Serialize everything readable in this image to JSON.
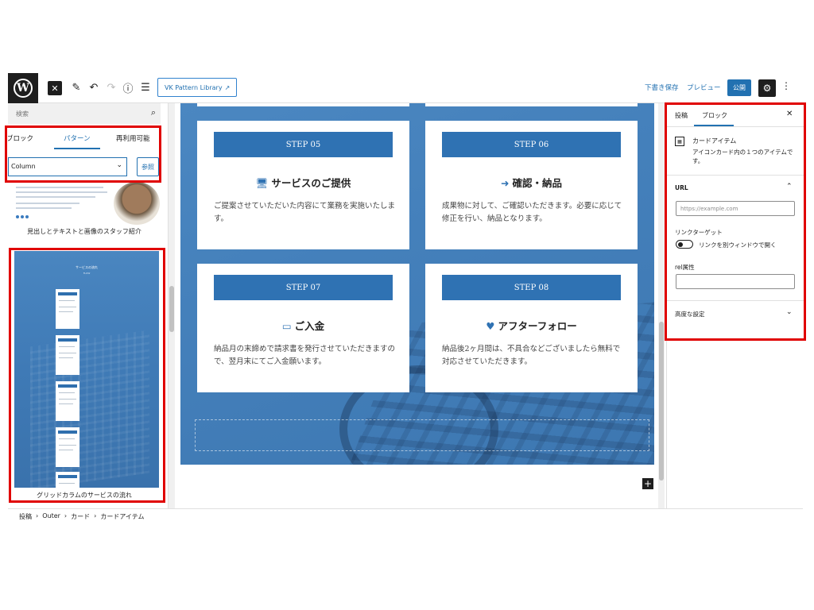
{
  "toolbar": {
    "close_icon": "close-icon",
    "pattern_library_label": "VK Pattern Library",
    "save_draft_label": "下書き保存",
    "preview_label": "プレビュー",
    "publish_label": "公開"
  },
  "inserter": {
    "search_placeholder": "検索",
    "tabs": [
      {
        "label": "ブロック"
      },
      {
        "label": "パターン"
      },
      {
        "label": "再利用可能"
      }
    ],
    "category_select": "Column",
    "browse_label": "参照",
    "patterns": [
      {
        "label": "見出しとテキストと画像のスタッフ紹介"
      },
      {
        "label": "グリッドカラムのサービスの流れ",
        "preview_title": "サービスの流れ",
        "preview_subtitle": "FLOW"
      }
    ]
  },
  "canvas": {
    "cards": [
      {
        "step": "STEP 05",
        "icon": "monitor-icon",
        "icon_glyph": "🖥",
        "title": "サービスのご提供",
        "text": "ご提案させていただいた内容にて業務を実施いたします。"
      },
      {
        "step": "STEP 06",
        "icon": "sign-in-icon",
        "icon_glyph": "➜",
        "title": "確認・納品",
        "text": "成果物に対して、ご確認いただきます。必要に応じて修正を行い、納品となります。"
      },
      {
        "step": "STEP 07",
        "icon": "credit-card-icon",
        "icon_glyph": "▭",
        "title": "ご入金",
        "text": "納品月の末締めで請求書を発行させていただきますので、翌月末にてご入金願います。"
      },
      {
        "step": "STEP 08",
        "icon": "user-heart-icon",
        "icon_glyph": "♥",
        "title": "アフターフォロー",
        "text": "納品後2ヶ月間は、不具合などございましたら無料で対応させていただきます。"
      }
    ]
  },
  "sidebar": {
    "tabs": [
      {
        "label": "投稿"
      },
      {
        "label": "ブロック"
      }
    ],
    "block_name": "カードアイテム",
    "block_description": "アイコンカード内の１つのアイテムです。",
    "url_section": "URL",
    "url_placeholder": "https://example.com",
    "link_target_label": "リンクターゲット",
    "link_target_toggle_label": "リンクを別ウィンドウで開く",
    "rel_label": "rel属性",
    "advanced_label": "高度な設定"
  },
  "breadcrumb": [
    "投稿",
    "Outer",
    "カード",
    "カードアイテム"
  ],
  "colors": {
    "accent": "#2271b1",
    "step_bar": "#2f72b3",
    "highlight": "#e00000",
    "cover": "#4480bb"
  }
}
